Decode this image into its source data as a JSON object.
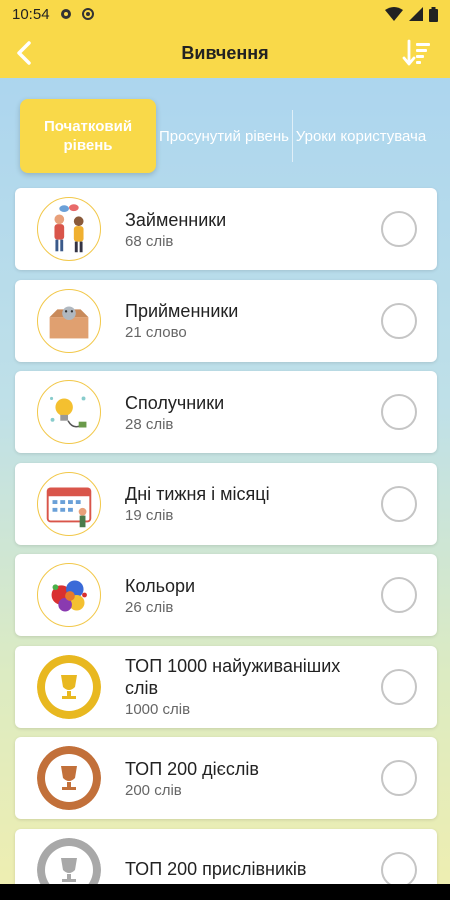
{
  "status_bar": {
    "time": "10:54",
    "icons": [
      "gear-icon",
      "settings-icon",
      "wifi-icon",
      "signal-icon",
      "battery-icon"
    ]
  },
  "app_bar": {
    "title": "Вивчення",
    "back_icon": "back-arrow-icon",
    "sort_icon": "sort-icon"
  },
  "tabs": [
    {
      "label": "Початковий рівень",
      "active": true
    },
    {
      "label": "Просунутий рівень",
      "active": false
    },
    {
      "label": "Уроки користувача",
      "active": false
    }
  ],
  "items": [
    {
      "name": "Займенники",
      "count": "68 слів",
      "icon": "people-talking-icon"
    },
    {
      "name": "Прийменники",
      "count": "21 слово",
      "icon": "box-icon"
    },
    {
      "name": "Сполучники",
      "count": "28 слів",
      "icon": "lightbulb-icon"
    },
    {
      "name": "Дні тижня і місяці",
      "count": "19 слів",
      "icon": "calendar-icon"
    },
    {
      "name": "Кольори",
      "count": "26 слів",
      "icon": "paint-splash-icon"
    },
    {
      "name": "ТОП 1000 найуживаніших слів",
      "count": "1000 слів",
      "icon": "gold-trophy-icon"
    },
    {
      "name": "ТОП 200 дієслів",
      "count": "200 слів",
      "icon": "bronze-trophy-icon"
    },
    {
      "name": "ТОП 200 прислівників",
      "count": "",
      "icon": "silver-trophy-icon"
    }
  ],
  "colors": {
    "accent": "#f9d949",
    "gold": "#e8b820",
    "bronze": "#c2703a",
    "silver": "#a8a8a8"
  }
}
